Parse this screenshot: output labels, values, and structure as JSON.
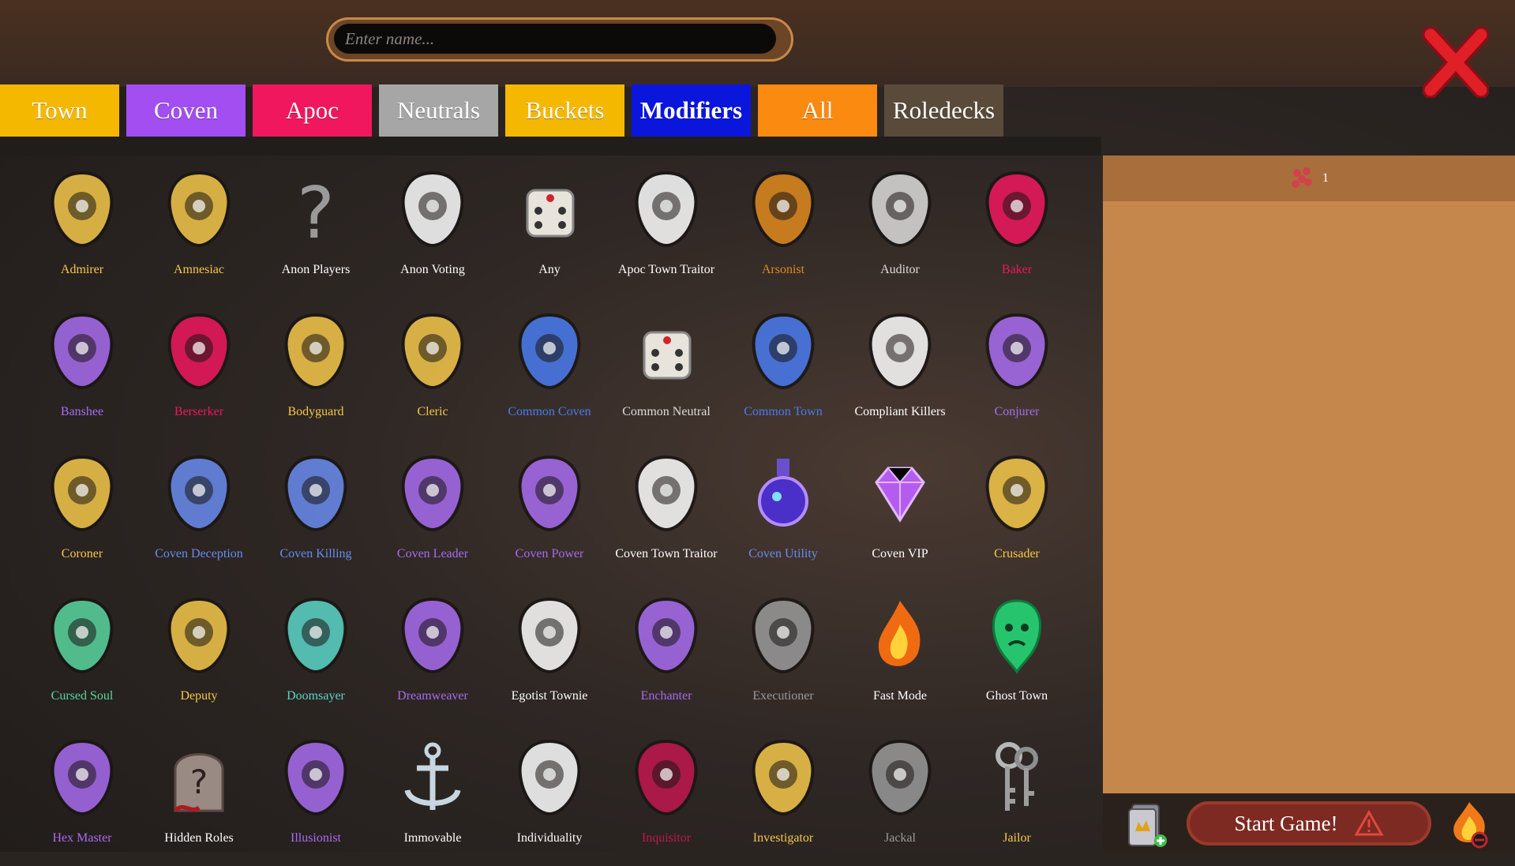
{
  "search": {
    "placeholder": "Enter name..."
  },
  "tabs": [
    {
      "label": "Town",
      "color": "#f5b800"
    },
    {
      "label": "Coven",
      "color": "#a24ef0"
    },
    {
      "label": "Apoc",
      "color": "#f0175f"
    },
    {
      "label": "Neutrals",
      "color": "#a6a6a6"
    },
    {
      "label": "Buckets",
      "color": "#f5b800"
    },
    {
      "label": "Modifiers",
      "color": "#0b16dc",
      "active": true
    },
    {
      "label": "All",
      "color": "#fb8a10"
    },
    {
      "label": "Roledecks",
      "color": "#5a4a3a"
    }
  ],
  "panel": {
    "count": "1"
  },
  "footer": {
    "start_label": "Start Game!"
  },
  "roles": [
    {
      "label": "Admirer",
      "color": "#f5c84b",
      "icon": "cupid-icon"
    },
    {
      "label": "Amnesiac",
      "color": "#f5c84b",
      "icon": "ghost-icon"
    },
    {
      "label": "Anon Players",
      "color": "#ffffff",
      "icon": "question-mark-icon"
    },
    {
      "label": "Anon Voting",
      "color": "#ffffff",
      "icon": "voting-card-icon"
    },
    {
      "label": "Any",
      "color": "#ffffff",
      "icon": "dice-icon"
    },
    {
      "label": "Apoc Town Traitor",
      "color": "#ffffff",
      "icon": "helmet-icon"
    },
    {
      "label": "Arsonist",
      "color": "#e08a1e",
      "icon": "torch-icon"
    },
    {
      "label": "Auditor",
      "color": "#dddddd",
      "icon": "briefcase-icon"
    },
    {
      "label": "Baker",
      "color": "#f0175f",
      "icon": "flour-sack-icon"
    },
    {
      "label": "Banshee",
      "color": "#a86cf0",
      "icon": "banshee-icon"
    },
    {
      "label": "Berserker",
      "color": "#f0175f",
      "icon": "beast-icon"
    },
    {
      "label": "Bodyguard",
      "color": "#f5c84b",
      "icon": "shield-axe-icon"
    },
    {
      "label": "Cleric",
      "color": "#f5c84b",
      "icon": "caduceus-icon"
    },
    {
      "label": "Common Coven",
      "color": "#4a7bf0",
      "icon": "broom-icon"
    },
    {
      "label": "Common Neutral",
      "color": "#dddddd",
      "icon": "dice-icon"
    },
    {
      "label": "Common Town",
      "color": "#4a7bf0",
      "icon": "pilgrim-hat-icon"
    },
    {
      "label": "Compliant Killers",
      "color": "#ffffff",
      "icon": "crossed-axes-icon"
    },
    {
      "label": "Conjurer",
      "color": "#a86cf0",
      "icon": "magic-hand-icon"
    },
    {
      "label": "Coroner",
      "color": "#f5c84b",
      "icon": "saw-icon"
    },
    {
      "label": "Coven Deception",
      "color": "#6a8cf0",
      "icon": "snake-icon"
    },
    {
      "label": "Coven Killing",
      "color": "#6a8cf0",
      "icon": "cauldron-icon"
    },
    {
      "label": "Coven Leader",
      "color": "#a86cf0",
      "icon": "witch-hat-icon"
    },
    {
      "label": "Coven Power",
      "color": "#a86cf0",
      "icon": "wand-icon"
    },
    {
      "label": "Coven Town Traitor",
      "color": "#ffffff",
      "icon": "witch-face-icon"
    },
    {
      "label": "Coven Utility",
      "color": "#6a8cf0",
      "icon": "potion-icon"
    },
    {
      "label": "Coven VIP",
      "color": "#ffffff",
      "icon": "gem-icon"
    },
    {
      "label": "Crusader",
      "color": "#f5c84b",
      "icon": "cross-icon"
    },
    {
      "label": "Cursed Soul",
      "color": "#5ad6a0",
      "icon": "cursed-soul-icon"
    },
    {
      "label": "Deputy",
      "color": "#f5c84b",
      "icon": "cowboy-hat-icon"
    },
    {
      "label": "Doomsayer",
      "color": "#5ad6c8",
      "icon": "orrery-icon"
    },
    {
      "label": "Dreamweaver",
      "color": "#a86cf0",
      "icon": "dreamcatcher-icon"
    },
    {
      "label": "Egotist Townie",
      "color": "#ffffff",
      "icon": "puppet-icon"
    },
    {
      "label": "Enchanter",
      "color": "#a86cf0",
      "icon": "paper-crane-icon"
    },
    {
      "label": "Executioner",
      "color": "#9a9a9a",
      "icon": "axe-icon"
    },
    {
      "label": "Fast Mode",
      "color": "#ffffff",
      "icon": "fire-icon"
    },
    {
      "label": "Ghost Town",
      "color": "#ffffff",
      "icon": "green-ghost-icon"
    },
    {
      "label": "Hex Master",
      "color": "#a86cf0",
      "icon": "hex-icon"
    },
    {
      "label": "Hidden Roles",
      "color": "#ffffff",
      "icon": "tombstone-icon"
    },
    {
      "label": "Illusionist",
      "color": "#a86cf0",
      "icon": "rabbit-hat-icon"
    },
    {
      "label": "Immovable",
      "color": "#ffffff",
      "icon": "anchor-icon"
    },
    {
      "label": "Individuality",
      "color": "#ffffff",
      "icon": "comet-icon"
    },
    {
      "label": "Inquisitor",
      "color": "#c0174f",
      "icon": "inquisitor-icon"
    },
    {
      "label": "Investigator",
      "color": "#f5c84b",
      "icon": "pipe-icon"
    },
    {
      "label": "Jackal",
      "color": "#9a9a9a",
      "icon": "hood-icon"
    },
    {
      "label": "Jailor",
      "color": "#f5c84b",
      "icon": "keys-icon"
    }
  ]
}
